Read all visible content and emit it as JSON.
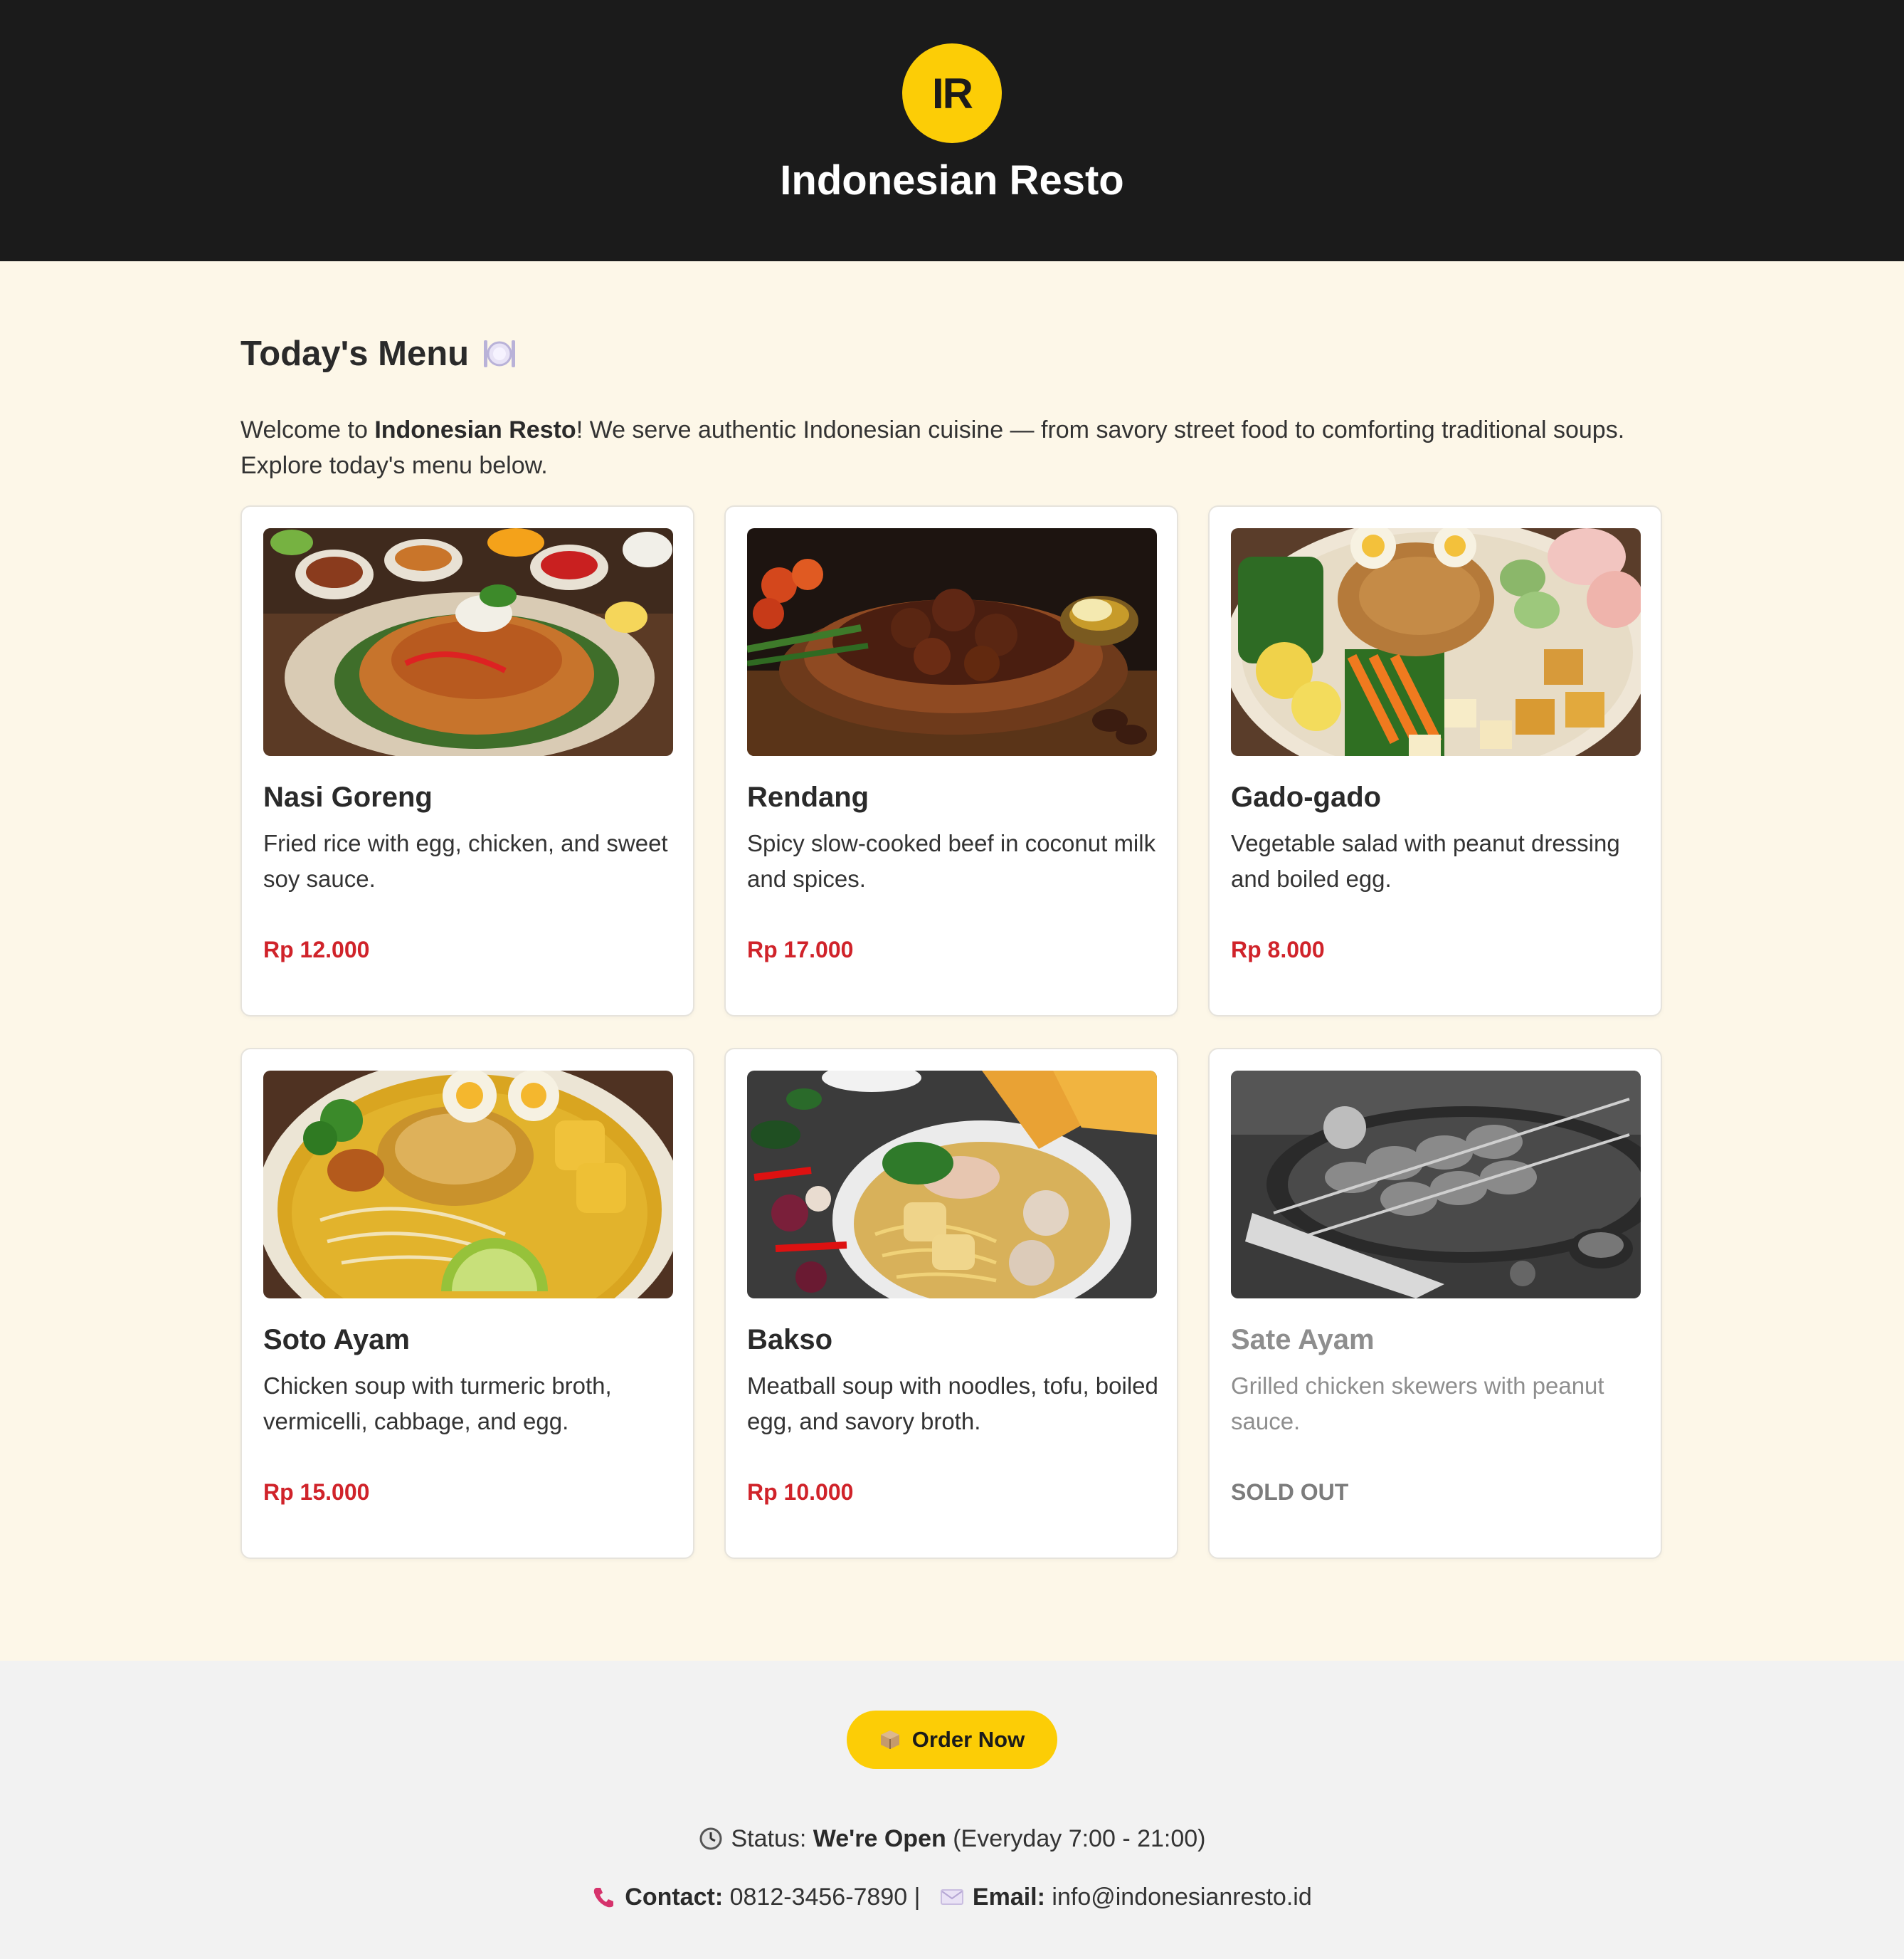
{
  "header": {
    "logo_text": "IR",
    "brand_name": "Indonesian Resto"
  },
  "menu": {
    "title": "Today's Menu",
    "title_icon": "plate-cutlery-icon",
    "intro_prefix": "Welcome to ",
    "intro_brand": "Indonesian Resto",
    "intro_suffix": "! We serve authentic Indonesian cuisine — from savory street food to comforting traditional soups. Explore today's menu below."
  },
  "items": [
    {
      "name": "Nasi Goreng",
      "description": "Fried rice with egg, chicken, and sweet soy sauce.",
      "price": "Rp 12.000",
      "sold_out": false
    },
    {
      "name": "Rendang",
      "description": "Spicy slow-cooked beef in coconut milk and spices.",
      "price": "Rp 17.000",
      "sold_out": false
    },
    {
      "name": "Gado-gado",
      "description": "Vegetable salad with peanut dressing and boiled egg.",
      "price": "Rp 8.000",
      "sold_out": false
    },
    {
      "name": "Soto Ayam",
      "description": "Chicken soup with turmeric broth, vermicelli, cabbage, and egg.",
      "price": "Rp 15.000",
      "sold_out": false
    },
    {
      "name": "Bakso",
      "description": "Meatball soup with noodles, tofu, boiled egg, and savory broth.",
      "price": "Rp 10.000",
      "sold_out": false
    },
    {
      "name": "Sate Ayam",
      "description": "Grilled chicken skewers with peanut sauce.",
      "price": "SOLD OUT",
      "sold_out": true
    }
  ],
  "footer": {
    "order_button_label": "Order Now",
    "order_icon": "package-icon",
    "status_label": "Status:",
    "status_value": "We're Open",
    "status_hours": "(Everyday 7:00 - 21:00)",
    "contact_label": "Contact:",
    "contact_phone": "0812-3456-7890",
    "separator": "|",
    "email_label": "Email:",
    "email_value": "info@indonesianresto.id"
  },
  "colors": {
    "header_bg": "#1b1b1b",
    "accent_yellow": "#fccd06",
    "page_bg": "#fdf7e8",
    "price_red": "#d0232a",
    "footer_bg": "#f2f2f2"
  }
}
